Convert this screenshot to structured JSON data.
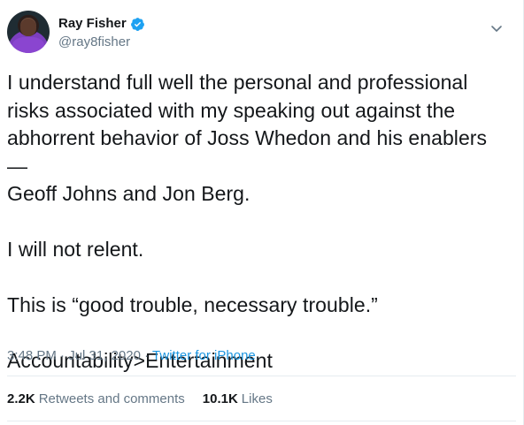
{
  "author": {
    "display_name": "Ray Fisher",
    "handle": "@ray8fisher",
    "verified": true
  },
  "tweet": {
    "text": "I understand full well the personal and professional\nrisks associated with my speaking out against the\nabhorrent behavior of Joss Whedon and his enablers—\nGeoff Johns and Jon Berg.\n\nI will not relent.\n\nThis is “good trouble, necessary trouble.”\n\nAccountability>Entertainment",
    "time": "3:48 PM",
    "date": "Jul 31, 2020",
    "separator": "·",
    "source": "Twitter for iPhone"
  },
  "stats": {
    "retweets_count": "2.2K",
    "retweets_label": "Retweets and comments",
    "likes_count": "10.1K",
    "likes_label": "Likes"
  },
  "icons": {
    "verified_badge": "verified-badge-icon",
    "more_menu": "chevron-down-icon"
  },
  "colors": {
    "accent": "#1b95e0",
    "verified": "#1da1f2",
    "secondary_text": "#657786",
    "divider": "#e6ecf0"
  }
}
